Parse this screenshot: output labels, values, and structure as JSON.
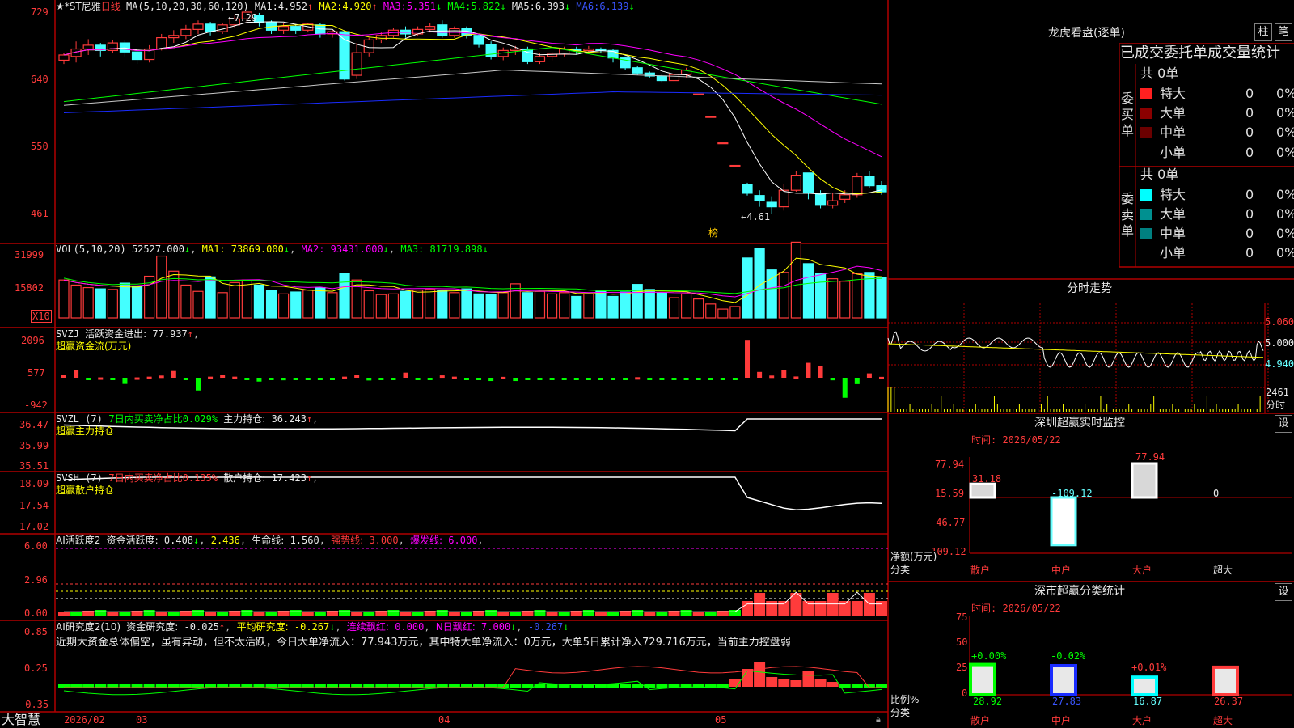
{
  "app_name": "大智慧",
  "colors": {
    "up": "#ff3b3b",
    "down": "#44ffff",
    "grid": "#b00000",
    "ma1": "#ffffff",
    "ma2": "#ffff00",
    "ma3": "#ff00ff",
    "ma4": "#00ff00",
    "ma5": "#c8c8c8",
    "ma6": "#1a2cff"
  },
  "price_panel": {
    "stock": "★*ST尼雅",
    "period": "日线",
    "ma_label": "MA(5,10,20,30,60,120)",
    "ma": [
      {
        "k": "MA1:",
        "v": "4.952",
        "dir": "↑"
      },
      {
        "k": "MA2:",
        "v": "4.920",
        "dir": "↑"
      },
      {
        "k": "MA3:",
        "v": "5.351",
        "dir": "↓"
      },
      {
        "k": "MA4:",
        "v": "5.822",
        "dir": "↓"
      },
      {
        "k": "MA5:",
        "v": "6.393",
        "dir": "↓"
      },
      {
        "k": "MA6:",
        "v": "6.139",
        "dir": "↓"
      }
    ],
    "y_ticks": [
      "729",
      "640",
      "550",
      "461"
    ],
    "high": "7.29",
    "low": "4.61",
    "mark": "榜",
    "candles": [
      [
        6.65,
        6.72,
        6.6,
        6.75
      ],
      [
        6.7,
        6.8,
        6.62,
        6.9
      ],
      [
        6.8,
        6.85,
        6.72,
        6.93
      ],
      [
        6.85,
        6.78,
        6.7,
        6.88
      ],
      [
        6.78,
        6.88,
        6.75,
        6.92
      ],
      [
        6.88,
        6.76,
        6.7,
        6.92
      ],
      [
        6.76,
        6.66,
        6.6,
        6.79
      ],
      [
        6.66,
        6.8,
        6.62,
        6.85
      ],
      [
        6.8,
        6.95,
        6.78,
        7.0
      ],
      [
        6.95,
        6.98,
        6.88,
        7.05
      ],
      [
        6.98,
        7.06,
        6.93,
        7.12
      ],
      [
        7.06,
        7.13,
        7.0,
        7.18
      ],
      [
        7.13,
        7.03,
        6.98,
        7.16
      ],
      [
        7.03,
        7.12,
        7.0,
        7.15
      ],
      [
        7.12,
        7.2,
        7.08,
        7.25
      ],
      [
        7.2,
        7.29,
        7.15,
        7.29
      ],
      [
        7.25,
        7.15,
        7.1,
        7.28
      ],
      [
        7.15,
        7.05,
        7.0,
        7.18
      ],
      [
        7.05,
        7.1,
        7.0,
        7.14
      ],
      [
        7.1,
        7.05,
        7.0,
        7.12
      ],
      [
        7.05,
        7.13,
        7.02,
        7.15
      ],
      [
        7.12,
        7.0,
        6.95,
        7.14
      ],
      [
        7.0,
        7.03,
        6.95,
        7.06
      ],
      [
        7.03,
        6.4,
        6.38,
        7.05
      ],
      [
        6.45,
        6.75,
        6.4,
        6.88
      ],
      [
        6.75,
        6.92,
        6.7,
        6.95
      ],
      [
        6.92,
        6.98,
        6.88,
        7.02
      ],
      [
        6.98,
        7.05,
        6.95,
        7.08
      ],
      [
        7.05,
        7.0,
        6.95,
        7.1
      ],
      [
        7.0,
        7.06,
        6.98,
        7.1
      ],
      [
        7.06,
        7.1,
        7.02,
        7.15
      ],
      [
        7.12,
        6.98,
        6.95,
        7.18
      ],
      [
        6.98,
        7.07,
        6.95,
        7.1
      ],
      [
        7.07,
        6.98,
        6.94,
        7.1
      ],
      [
        6.98,
        6.86,
        6.82,
        7.0
      ],
      [
        6.86,
        6.7,
        6.66,
        6.9
      ],
      [
        6.7,
        6.78,
        6.65,
        6.82
      ],
      [
        6.78,
        6.8,
        6.72,
        6.84
      ],
      [
        6.8,
        6.63,
        6.6,
        6.83
      ],
      [
        6.63,
        6.7,
        6.6,
        6.74
      ],
      [
        6.7,
        6.73,
        6.65,
        6.76
      ],
      [
        6.73,
        6.8,
        6.7,
        6.83
      ],
      [
        6.8,
        6.78,
        6.73,
        6.83
      ],
      [
        6.78,
        6.8,
        6.74,
        6.84
      ],
      [
        6.8,
        6.78,
        6.74,
        6.82
      ],
      [
        6.78,
        6.68,
        6.62,
        6.8
      ],
      [
        6.68,
        6.55,
        6.52,
        6.7
      ],
      [
        6.55,
        6.48,
        6.45,
        6.58
      ],
      [
        6.48,
        6.44,
        6.42,
        6.5
      ],
      [
        6.44,
        6.38,
        6.36,
        6.46
      ],
      [
        6.38,
        6.46,
        6.36,
        6.5
      ],
      [
        6.46,
        6.52,
        6.42,
        6.55
      ],
      [
        6.2,
        6.2,
        6.2,
        6.2
      ],
      [
        5.9,
        5.9,
        5.9,
        5.9
      ],
      [
        5.55,
        5.55,
        5.55,
        5.55
      ],
      [
        5.25,
        5.25,
        5.25,
        5.25
      ],
      [
        5.0,
        4.88,
        4.85,
        5.02
      ],
      [
        4.85,
        4.78,
        4.7,
        4.92
      ],
      [
        4.76,
        4.7,
        4.61,
        4.84
      ],
      [
        4.7,
        4.92,
        4.65,
        5.0
      ],
      [
        4.92,
        5.12,
        4.9,
        5.18
      ],
      [
        5.15,
        4.88,
        4.8,
        5.15
      ],
      [
        4.88,
        4.72,
        4.68,
        4.92
      ],
      [
        4.72,
        4.78,
        4.68,
        4.88
      ],
      [
        4.8,
        4.86,
        4.75,
        4.92
      ],
      [
        4.86,
        5.1,
        4.82,
        5.15
      ],
      [
        5.1,
        4.98,
        4.95,
        5.18
      ],
      [
        4.98,
        4.9,
        4.86,
        5.04
      ]
    ]
  },
  "vol_panel": {
    "label": "VOL(5,10,20)",
    "val": "52527.000",
    "dir": "↓",
    "ma": [
      {
        "k": "MA1:",
        "v": "73869.000",
        "dir": "↓"
      },
      {
        "k": "MA2:",
        "v": "93431.000",
        "dir": "↓"
      },
      {
        "k": "MA3:",
        "v": "81719.898",
        "dir": "↓"
      }
    ],
    "y_ticks": [
      "31999",
      "15802"
    ],
    "unit": "X10",
    "values": [
      60,
      52,
      48,
      46,
      45,
      55,
      50,
      66,
      98,
      74,
      52,
      42,
      65,
      40,
      56,
      60,
      52,
      44,
      38,
      41,
      44,
      48,
      40,
      70,
      60,
      43,
      37,
      38,
      42,
      44,
      45,
      43,
      40,
      46,
      38,
      37,
      40,
      54,
      40,
      42,
      38,
      40,
      34,
      38,
      42,
      34,
      41,
      53,
      45,
      40,
      32,
      38,
      30,
      22,
      14,
      18,
      95,
      110,
      76,
      72,
      120,
      86,
      70,
      62,
      58,
      70,
      72,
      64
    ]
  },
  "svzj_panel": {
    "name": "SVZJ",
    "text": "活跃资金进出:",
    "val": "77.937",
    "dir": "↑",
    "sub": "超赢资金流(万元)",
    "y_ticks": [
      "2096",
      "577",
      "-942"
    ],
    "values": [
      150,
      420,
      -120,
      20,
      -80,
      -340,
      20,
      60,
      120,
      370,
      -120,
      -700,
      60,
      160,
      60,
      -110,
      -210,
      -60,
      -140,
      -60,
      -90,
      -90,
      -80,
      60,
      150,
      -150,
      -60,
      -100,
      280,
      -100,
      -70,
      130,
      60,
      -60,
      -110,
      -180,
      50,
      -180,
      -60,
      -110,
      -70,
      -60,
      -100,
      -70,
      -70,
      -60,
      -60,
      30,
      -40,
      -60,
      -40,
      -30,
      -40,
      -20,
      -10,
      -10,
      2080,
      320,
      120,
      440,
      70,
      820,
      630,
      -140,
      -1100,
      -350,
      240,
      50,
      -80,
      990,
      -420,
      -40
    ]
  },
  "svzl_panel": {
    "name": "SVZL",
    "param": "(7)",
    "sub1": "7日内买卖净占比",
    "v1": "0.029%",
    "sub2": "主力持仓:",
    "v2": "36.243",
    "dir": "↑",
    "sub": "超赢主力持仓",
    "y_ticks": [
      "36.47",
      "35.99",
      "35.51"
    ]
  },
  "svsh_panel": {
    "name": "SVSH",
    "param": "(7)",
    "sub1": "7日内买卖净占比",
    "v1": "0.135%",
    "sub2": "散户持仓:",
    "v2": "17.423",
    "dir": "↑",
    "sub": "超赢散户持仓",
    "y_ticks": [
      "18.09",
      "17.54",
      "17.02"
    ]
  },
  "ai1_panel": {
    "name": "AI活跃度2",
    "t1": "资金活跃度:",
    "v1": "0.408",
    "d1": "↓",
    "v2": "2.436",
    "t3": "生命线:",
    "v3": "1.560",
    "t4": "强势线:",
    "v4": "3.000",
    "t5": "爆发线:",
    "v5": "6.000",
    "y_ticks": [
      "6.00",
      "2.96",
      "0.00"
    ]
  },
  "ai2_panel": {
    "name": "AI研究度2(10)",
    "t1": "资金研究度:",
    "v1": "-0.025",
    "d1": "↑",
    "t2": "平均研究度:",
    "v2": "-0.267",
    "d2": "↓",
    "t3": "连续飘红:",
    "v3": "0.000",
    "t4": "N日飘红:",
    "v4": "7.000",
    "d4": "↓",
    "v5": "-0.267",
    "d5": "↓",
    "comment": "近期大资金总体偏空，虽有异动，但不太活跃，今日大单净流入：77.943万元，其中特大单净流入：0万元，大单5日累计净入729.716万元，当前主力控盘弱",
    "y_ticks": [
      "0.85",
      "0.25",
      "-0.35"
    ]
  },
  "x_axis": [
    "2026/02",
    "03",
    "04",
    "05"
  ],
  "right": {
    "dragon_title": "龙虎看盘(逐单)",
    "btn_bar": "柱",
    "btn_pen": "笔",
    "stat_header": "已成交委托单成交量统计",
    "buy": {
      "total": "共 0单",
      "side": "委买单",
      "rows": [
        {
          "name": "特大",
          "n": "0",
          "p": "0%",
          "c": "#ff2020"
        },
        {
          "name": "大单",
          "n": "0",
          "p": "0%",
          "c": "#8b0000"
        },
        {
          "name": "中单",
          "n": "0",
          "p": "0%",
          "c": "#6b0000"
        },
        {
          "name": "小单",
          "n": "0",
          "p": "0%",
          "c": "#000000"
        }
      ]
    },
    "sell": {
      "total": "共 0单",
      "side": "委卖单",
      "rows": [
        {
          "name": "特大",
          "n": "0",
          "p": "0%",
          "c": "#00ffff"
        },
        {
          "name": "大单",
          "n": "0",
          "p": "0%",
          "c": "#009090"
        },
        {
          "name": "中单",
          "n": "0",
          "p": "0%",
          "c": "#008080"
        },
        {
          "name": "小单",
          "n": "0",
          "p": "0%",
          "c": "#000000"
        }
      ]
    },
    "intraday": {
      "title": "分时走势",
      "ticks": [
        "5.060",
        "5.000",
        "4.940"
      ],
      "vol": "2461",
      "vol_label": "分时"
    },
    "monitor": {
      "title": "深圳超赢实时监控",
      "btn": "设",
      "time": "时间: 2026/05/22",
      "y_ticks": [
        "77.94",
        "15.59",
        "-46.77",
        "-109.12"
      ],
      "ylabel": "净额(万元)",
      "xlabel": "分类",
      "cats": [
        "散户",
        "中户",
        "大户",
        "超大"
      ],
      "values": [
        31.18,
        -109.12,
        77.94,
        0
      ],
      "labels": [
        "31.18",
        "-109.12",
        "77.94",
        "0"
      ]
    },
    "classify": {
      "title": "深市超赢分类统计",
      "btn": "设",
      "time": "时间: 2026/05/22",
      "y_ticks": [
        "75",
        "50",
        "25",
        "0"
      ],
      "ylabel": "比例%",
      "xlabel": "分类",
      "cats": [
        "散户",
        "中户",
        "大户",
        "超大"
      ],
      "values": [
        28.92,
        27.83,
        16.87,
        26.37
      ],
      "chg": [
        "+0.00%",
        "-0.02%",
        "+0.01%",
        ""
      ]
    }
  }
}
